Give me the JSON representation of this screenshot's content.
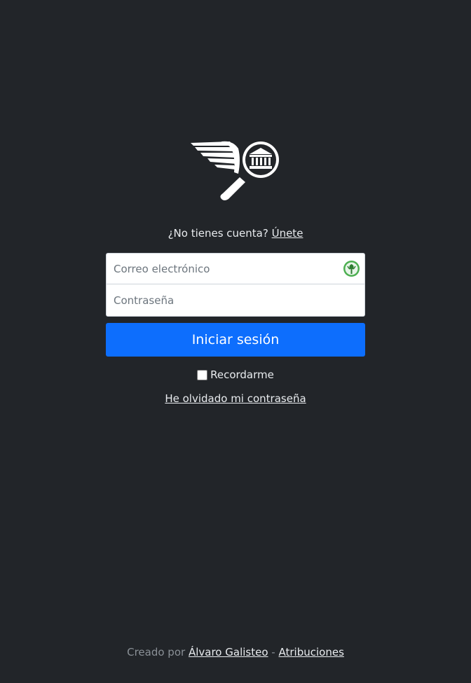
{
  "signup": {
    "prompt": "¿No tienes cuenta?",
    "link": "Únete"
  },
  "form": {
    "email_placeholder": "Correo electrónico",
    "password_placeholder": "Contraseña",
    "password_manager_icon": "password-manager-icon",
    "login_button": "Iniciar sesión",
    "remember_label": "Recordarme",
    "remember_checked": false,
    "forgot_link": "He olvidado mi contraseña"
  },
  "footer": {
    "created_by": "Creado por",
    "author": "Álvaro Galisteo",
    "separator": "-",
    "attributions": "Atribuciones"
  },
  "colors": {
    "background": "#222529",
    "primary": "#0d6efd",
    "input_bg": "#ffffff"
  }
}
